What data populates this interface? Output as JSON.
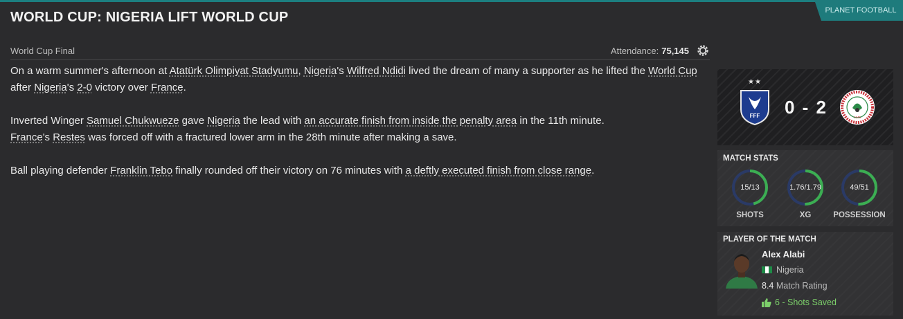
{
  "source_tab": "PLANET FOOTBALL",
  "headline": "WORLD CUP: NIGERIA LIFT WORLD CUP",
  "competition": "World Cup Final",
  "attendance": {
    "label": "Attendance:",
    "value": "75,145"
  },
  "article": {
    "p1": {
      "t1": "On a warm summer's afternoon at ",
      "stadium": "Atatürk Olimpiyat Stadyumu",
      "t2": ", ",
      "team1": "Nigeria",
      "t3": "'s ",
      "captain": "Wilfred Ndidi",
      "t4": " lived the dream of many a supporter as he lifted the ",
      "cup": "World Cup",
      "t5": " after ",
      "team2": "Nigeria",
      "t6": "'s ",
      "score": "2-0",
      "t7": " victory over ",
      "opp": "France",
      "t8": "."
    },
    "p2": {
      "t1": "Inverted Winger ",
      "scorer": "Samuel Chukwueze",
      "t2": " gave ",
      "team": "Nigeria",
      "t3": " the lead with ",
      "goal": "an accurate finish from inside the penalty area",
      "t4": " in the 11th minute.",
      "opp": "France",
      "t5": "'s ",
      "keeper": "Restes",
      "t6": " was forced off with a fractured lower arm in the 28th minute after making a save."
    },
    "p3": {
      "t1": "Ball playing defender ",
      "scorer": "Franklin Tebo",
      "t2": " finally rounded off their victory on 76 minutes with ",
      "goal": "a deftly executed finish from close range",
      "t3": "."
    }
  },
  "scoreboard": {
    "home_stars": "★★",
    "score": "0 - 2",
    "home_badge_text": "FFF",
    "away_badge_year": "1945"
  },
  "match_stats": {
    "title": "MATCH STATS",
    "items": [
      {
        "label": "SHOTS",
        "value": "15/13",
        "home": 15,
        "away": 13
      },
      {
        "label": "XG",
        "value": "1.76/1.79",
        "home": 1.76,
        "away": 1.79
      },
      {
        "label": "POSSESSION",
        "value": "49/51",
        "home": 49,
        "away": 51
      }
    ],
    "colors": {
      "home": "#2a3a66",
      "away": "#3cae52"
    }
  },
  "potm": {
    "title": "PLAYER OF THE MATCH",
    "name": "Alex Alabi",
    "nation": "Nigeria",
    "rating": "8.4",
    "rating_label": "Match Rating",
    "award": "6 - Shots Saved"
  },
  "colors": {
    "accent": "#1e7b7c",
    "award": "#7ccf6a"
  }
}
